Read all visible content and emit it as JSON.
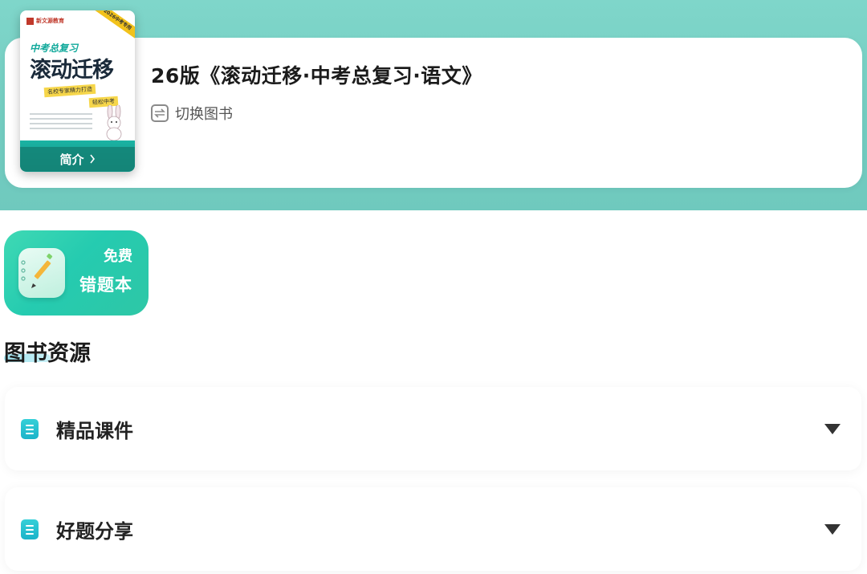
{
  "book": {
    "title": "26版《滚动迁移·中考总复习·语文》",
    "switch_label": "切换图书",
    "cover": {
      "publisher": "新文源教育",
      "ribbon": "2026中考专用",
      "subtitle": "中考总复习",
      "main_title": "滚动迁移",
      "slogan_1": "名校专家精力打造",
      "slogan_2": "轻松中考",
      "intro_label": "简介"
    }
  },
  "wrong_book": {
    "badge": "免费",
    "title": "错题本"
  },
  "resources": {
    "section_title": "图书资源",
    "items": [
      {
        "label": "精品课件"
      },
      {
        "label": "好题分享"
      }
    ]
  },
  "colors": {
    "header_bg": "#74cdc1",
    "accent_green": "#2ec7a6",
    "icon_teal": "#1ab3c9"
  }
}
